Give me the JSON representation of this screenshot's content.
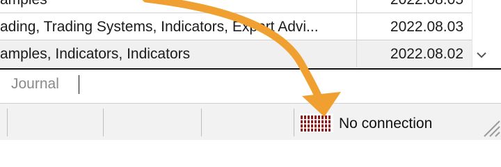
{
  "table": {
    "rows": [
      {
        "category": "amples",
        "date": "2022.08.05"
      },
      {
        "category": "ading, Trading Systems, Indicators, Expert Advi...",
        "date": "2022.08.03"
      },
      {
        "category": "amples, Indicators, Indicators",
        "date": "2022.08.02"
      }
    ],
    "scroll_down_icon": "chevron-down-icon"
  },
  "tabs": {
    "journal_label": "Journal"
  },
  "status": {
    "connection_text": "No connection",
    "connection_icon": "connection-status-bars-icon",
    "connection_icon_color": "#8b1a1a"
  },
  "annotation": {
    "arrow_color": "#f0a030"
  }
}
